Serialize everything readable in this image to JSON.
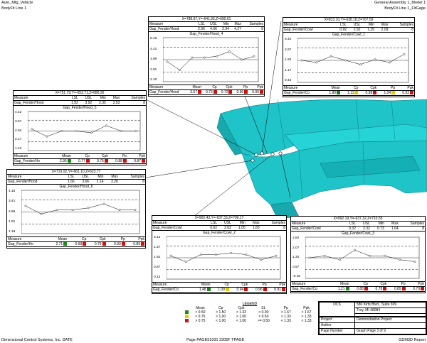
{
  "header": {
    "left_line1": "Auto_Mfg_Vehicle",
    "left_line2": "BodyFit Line 1",
    "right_line1": "General Assembly 1_Model 1",
    "right_line2": "BodyFit Line 1_FitGage"
  },
  "footer": {
    "left": "Dimensional Control Systems, Inc. DATE",
    "center": "Page PAGE51031 2305F TPAGE",
    "right": "GDM3D Report"
  },
  "colors": {
    "green": "#1a8a1a",
    "yellow": "#e8c800",
    "red": "#d01010",
    "car": "#1fc4c8"
  },
  "panels": {
    "p4": {
      "coord": "X=788.97,Y=-641.92,Z=690.61",
      "stats_headers": [
        "Measure",
        "LSL",
        "USL",
        "Min",
        "Max",
        "Samples"
      ],
      "stats_values": [
        "Gap_Fender/Hood",
        "2.66",
        "4.66",
        "2.94",
        "4.27",
        "8"
      ],
      "chart_title": "Gap_Fender/Hood_4",
      "y_labels": [
        "5.16",
        "4.41",
        "3.66",
        "2.91",
        "2.16"
      ],
      "idx_headers": [
        "Measure",
        "Mean",
        "Cp",
        "Cpk",
        "Pp",
        "Ppk"
      ],
      "idx_values": [
        "Gap_Fender/Hood",
        "3.67",
        "0.73",
        "0.72",
        "0.96",
        "0.95"
      ],
      "idx_colors": [
        "red",
        "red",
        "red",
        "red",
        "red"
      ]
    },
    "p1": {
      "coord": "X=813.10,Y=-638.18,Z=707.59",
      "stats_headers": [
        "Measure",
        "LSL",
        "USL",
        "Min",
        "Max",
        "Samples"
      ],
      "stats_values": [
        "Gap_Fender/Cowl",
        "0.92",
        "2.92",
        "1.29",
        "2.09",
        "8"
      ],
      "chart_title": "Gap_Fender/Cowl_1",
      "y_labels": [
        "3.42",
        "2.67",
        "1.92",
        "1.17",
        "0.42"
      ],
      "idx_headers": [
        "Measure",
        "Mean",
        "Cp",
        "Cpk",
        "Pp",
        "Ppk"
      ],
      "idx_values": [
        "Gap_Fender/Co",
        "1.80",
        "1.11",
        "0.98",
        "1.04",
        "0.92"
      ],
      "idx_colors": [
        "green",
        "yellow",
        "red",
        "yellow",
        "red"
      ]
    },
    "p5": {
      "coord": "X=751.79,Y=-653.71,Z=680.26",
      "stats_headers": [
        "Measure",
        "LSL",
        "USL",
        "Min",
        "Max",
        "Samples"
      ],
      "stats_values": [
        "Gap_Fender/Hood",
        "1.92",
        "3.92",
        "2.35",
        "3.53",
        "8"
      ],
      "chart_title": "Gap_Fender/Hood_5",
      "y_labels": [
        "4.42",
        "3.67",
        "2.92",
        "2.17",
        "1.42"
      ],
      "idx_headers": [
        "Measure",
        "Mean",
        "Cp",
        "Cpk",
        "Pp",
        "Ppk"
      ],
      "idx_values": [
        "Gap_Fender/Ho",
        "2.95",
        "0.77",
        "0.76",
        "0.88",
        "0.87"
      ],
      "idx_colors": [
        "green",
        "red",
        "red",
        "red",
        "red"
      ]
    },
    "p6": {
      "coord": "X=719.02,Y=-661.10,Z=623.77",
      "stats_headers": [
        "Measure",
        "LSL",
        "USL",
        "Min",
        "Max",
        "Samples"
      ],
      "stats_values": [
        "Gap_Fender/Hood",
        "1.66",
        "3.66",
        "2.14",
        "3.26",
        "8"
      ],
      "chart_title": "Gap_Fender/Hood_6",
      "y_labels": [
        "4.16",
        "3.41",
        "2.66",
        "1.91",
        "1.16"
      ],
      "idx_headers": [
        "Measure",
        "Mean",
        "Cp",
        "Cpk",
        "Pp",
        "Ppk"
      ],
      "idx_values": [
        "Gap_Fender/Ho",
        "2.71",
        "0.83",
        "0.79",
        "0.93",
        "0.89"
      ],
      "idx_colors": [
        "green",
        "red",
        "red",
        "red",
        "red"
      ]
    },
    "p2": {
      "coord": "X=902.43,Y=-637.33,Z=709.17",
      "stats_headers": [
        "Measure",
        "LSL",
        "USL",
        "Min",
        "Max",
        "Samples"
      ],
      "stats_values": [
        "Gap_Fender/Cowl",
        "0.62",
        "2.62",
        "1.05",
        "1.83",
        "8"
      ],
      "chart_title": "Gap_Fender/Cowl_2",
      "y_labels": [
        "3.12",
        "2.37",
        "1.62",
        "0.87",
        "0.12"
      ],
      "idx_headers": [
        "Measure",
        "Mean",
        "Cp",
        "Cpk",
        "Pp",
        "Ppk"
      ],
      "idx_values": [
        "Gap_Fender/Co",
        "1.48",
        "1.09",
        "0.94",
        "0.96",
        "0.91"
      ],
      "idx_colors": [
        "green",
        "yellow",
        "red",
        "red",
        "red"
      ]
    },
    "p3": {
      "coord": "X=992.19,Y=-637.32,Z=710.55",
      "stats_headers": [
        "Measure",
        "LSL",
        "USL",
        "Min",
        "Max",
        "Samples"
      ],
      "stats_values": [
        "Gap_Fender/Cowl",
        "0.32",
        "2.32",
        "0.73",
        "1.64",
        "8"
      ],
      "chart_title": "Gap_Fender/Cowl_3",
      "y_labels": [
        "2.82",
        "2.07",
        "1.32",
        "0.57",
        "-0.18"
      ],
      "idx_headers": [
        "Measure",
        "Mean",
        "Cp",
        "Cpk",
        "Pp",
        "Ppk"
      ],
      "idx_values": [
        "Gap_Fender/Co",
        "1.21",
        "0.88",
        "0.78",
        "0.89",
        "0.79"
      ],
      "idx_colors": [
        "green",
        "red",
        "red",
        "red",
        "red"
      ]
    }
  },
  "legend": {
    "title": "LEGEND",
    "headers": [
      "Mean",
      "Cp",
      "Cpk",
      "SL",
      "Pp",
      "Ppk"
    ],
    "rows": [
      [
        "< 0.50",
        "> 1.50",
        "> 1.33",
        "< 0.00",
        "> 1.67",
        "> 1.67"
      ],
      [
        "< 0.75",
        "> 1.00",
        "> 1.00",
        "< 0.50",
        "> 1.33",
        "> 1.33"
      ],
      [
        "> 0.75",
        "< 1.00",
        "< 1.00",
        ">= 0.50",
        "< 1.33",
        "< 1.33"
      ]
    ]
  },
  "titleblock": {
    "company": "DCS",
    "address1": "580 Kirts Blvd , Suite 309",
    "address2": "Troy, MI 48084",
    "project_label": "Project",
    "project_value": "Demonstration Project",
    "author_label": "Author",
    "author_value": "",
    "page_label": "Page Number",
    "page_value": "Graph Page 3 of 9"
  }
}
